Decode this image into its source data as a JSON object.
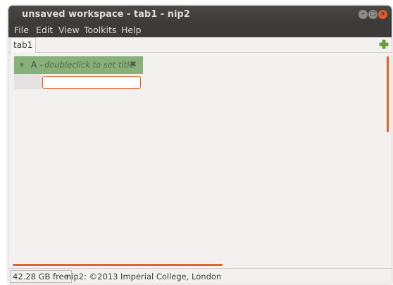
{
  "window": {
    "title": "unsaved workspace - tab1 - nip2",
    "min_glyph": "–",
    "max_glyph": "□",
    "close_glyph": "×"
  },
  "menubar": {
    "items": [
      "File",
      "Edit",
      "View",
      "Toolkits",
      "Help"
    ]
  },
  "tabs": {
    "active": "tab1",
    "add_icon": "plus-icon"
  },
  "column": {
    "name": "A -",
    "title_hint": "doubleclick to set title",
    "collapse_icon": "triangle-down-icon",
    "close_icon": "close-x-icon",
    "close_glyph": "✖",
    "header_color": "#88b07a"
  },
  "entry": {
    "value": ""
  },
  "status": {
    "free_space": "42.28 GB free",
    "message": "nip2: ©2013 Imperial College, London"
  },
  "colors": {
    "titlebar": "#3c3b37",
    "accent": "#e4622e",
    "background": "#f2f1f0"
  }
}
